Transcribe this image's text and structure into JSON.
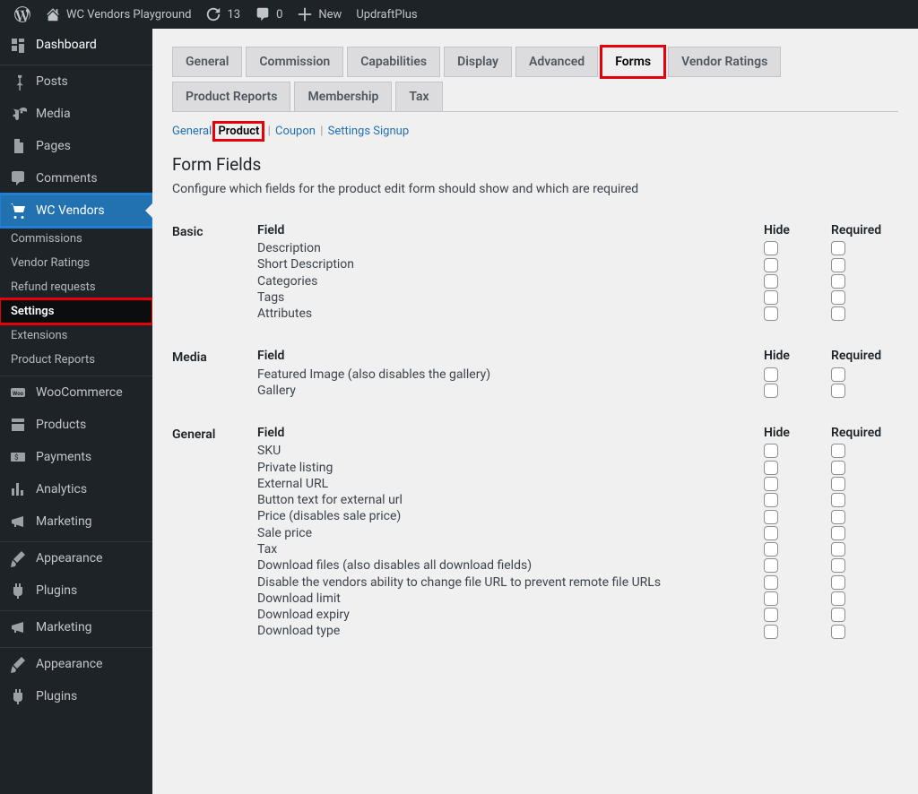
{
  "adminbar": {
    "site_name": "WC Vendors Playground",
    "updates": "13",
    "comments": "0",
    "new": "New",
    "updraft": "UpdraftPlus"
  },
  "sidebar": {
    "dashboard": "Dashboard",
    "posts": "Posts",
    "media": "Media",
    "pages": "Pages",
    "comments": "Comments",
    "wcvendors": "WC Vendors",
    "wcv_sub": {
      "commissions": "Commissions",
      "vendor_ratings": "Vendor Ratings",
      "refund_requests": "Refund requests",
      "settings": "Settings",
      "extensions": "Extensions",
      "product_reports": "Product Reports"
    },
    "woocommerce": "WooCommerce",
    "products": "Products",
    "payments": "Payments",
    "analytics": "Analytics",
    "marketing": "Marketing",
    "appearance": "Appearance",
    "plugins": "Plugins"
  },
  "tabs": [
    "General",
    "Commission",
    "Capabilities",
    "Display",
    "Advanced",
    "Forms",
    "Vendor Ratings",
    "Product Reports",
    "Membership",
    "Tax"
  ],
  "tabs_active_index": 5,
  "subtabs": [
    {
      "label": "General",
      "sep": false
    },
    {
      "label": "Product",
      "sep": false,
      "current": true
    },
    {
      "label": "Coupon",
      "sep": true
    },
    {
      "label": "Settings",
      "sep": true
    },
    {
      "label": "Signup",
      "sep": false
    }
  ],
  "heading": "Form Fields",
  "description": "Configure which fields for the product edit form should show and which are required",
  "col_hide": "Hide",
  "col_required": "Required",
  "col_field": "Field",
  "groups": [
    {
      "label": "Basic",
      "fields": [
        "Description",
        "Short Description",
        "Categories",
        "Tags",
        "Attributes"
      ]
    },
    {
      "label": "Media",
      "fields": [
        "Featured Image (also disables the gallery)",
        "Gallery"
      ]
    },
    {
      "label": "General",
      "fields": [
        "SKU",
        "Private listing",
        "External URL",
        "Button text for external url",
        "Price (disables sale price)",
        "Sale price",
        "Tax",
        "Download files (also disables all download fields)",
        "Disable the vendors ability to change file URL to prevent remote file URLs",
        "Download limit",
        "Download expiry",
        "Download type"
      ]
    }
  ]
}
